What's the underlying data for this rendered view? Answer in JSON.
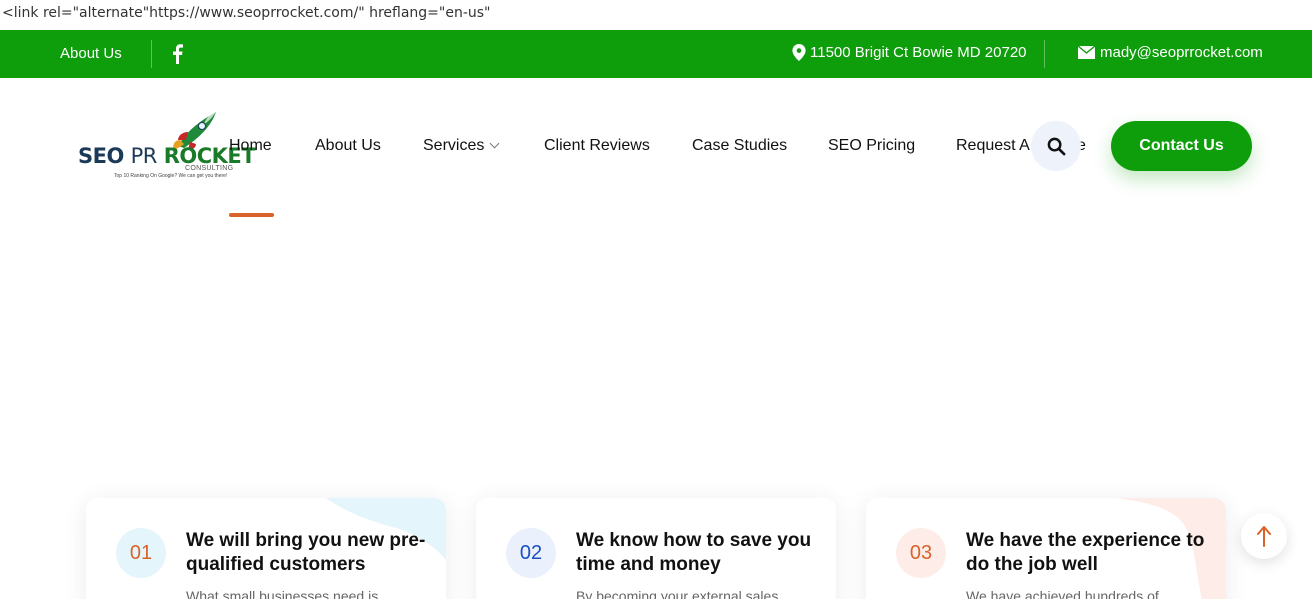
{
  "raw_text": "<link rel=\"alternate\"https://www.seoprrocket.com/\" hreflang=\"en-us\"",
  "topbar": {
    "about_label": "About Us",
    "facebook_icon": "facebook-icon",
    "address": "11500 Brigit Ct Bowie MD 20720",
    "email": "mady@seoprrocket.com",
    "bg_color": "#0e9e0b"
  },
  "logo": {
    "seo": "SEO",
    "pr": "PR",
    "rocket": "ROCKET",
    "consulting": "CONSULTING",
    "tagline": "Top 10 Ranking On Google? We can get you there!"
  },
  "nav": {
    "items": [
      {
        "label": "Home",
        "active": true
      },
      {
        "label": "About Us"
      },
      {
        "label": "Services",
        "has_dropdown": true
      },
      {
        "label": "Client Reviews"
      },
      {
        "label": "Case Studies"
      },
      {
        "label": "SEO Pricing"
      },
      {
        "label": "Request A"
      },
      {
        "label": "e"
      }
    ],
    "active_color": "#d9622b"
  },
  "search": {
    "icon": "search-icon"
  },
  "cta": {
    "label": "Contact Us",
    "color": "#0e9e0b"
  },
  "cards": [
    {
      "num": "01",
      "title": "We will bring you new pre-qualified customers",
      "desc": "What small businesses need is",
      "num_color": "#d9622b",
      "num_bg": "#e4f6fc"
    },
    {
      "num": "02",
      "title": "We know how to save you time and money",
      "desc": "By becoming your external sales",
      "num_color": "#1a4fc4",
      "num_bg": "#eaf0fc"
    },
    {
      "num": "03",
      "title": "We have the experience to do the job well",
      "desc": "We have achieved hundreds of",
      "num_color": "#d9622b",
      "num_bg": "#fdece7"
    }
  ],
  "scroll_top": {
    "icon": "arrow-up-icon"
  }
}
